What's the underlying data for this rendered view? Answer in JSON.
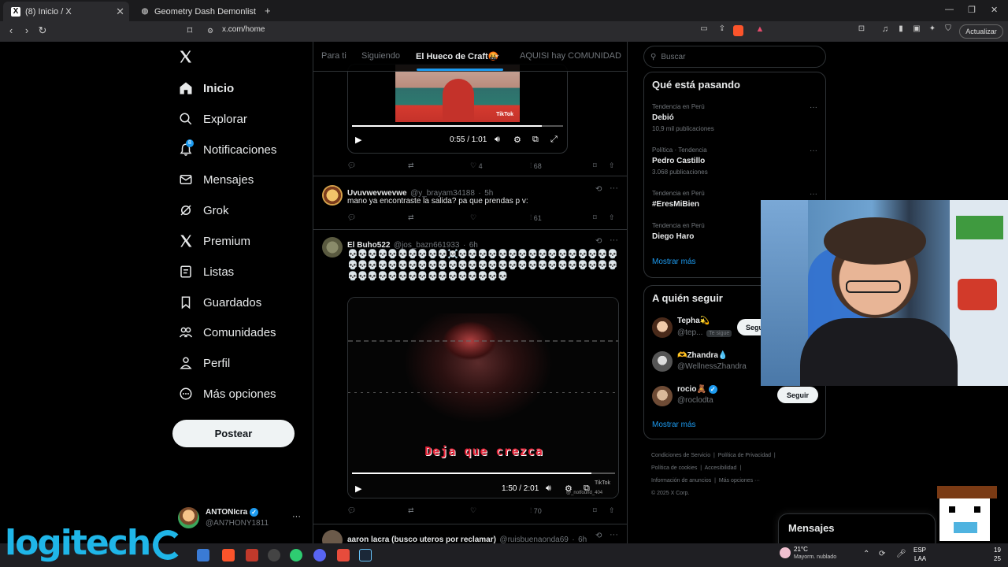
{
  "browser": {
    "tabs": [
      {
        "title": "(8) Inicio / X",
        "icon": "x-logo-icon",
        "active": true
      },
      {
        "title": "Geometry Dash Demonlist",
        "icon": "globe-icon",
        "active": false
      }
    ],
    "url": "x.com/home",
    "update_label": "Actualizar"
  },
  "sidebar": {
    "items": [
      {
        "label": "Inicio",
        "icon": "home-icon"
      },
      {
        "label": "Explorar",
        "icon": "search-icon"
      },
      {
        "label": "Notificaciones",
        "icon": "bell-icon",
        "badge": "8"
      },
      {
        "label": "Mensajes",
        "icon": "mail-icon"
      },
      {
        "label": "Grok",
        "icon": "grok-icon"
      },
      {
        "label": "Premium",
        "icon": "x-logo-icon"
      },
      {
        "label": "Listas",
        "icon": "list-icon"
      },
      {
        "label": "Guardados",
        "icon": "bookmark-icon"
      },
      {
        "label": "Comunidades",
        "icon": "communities-icon"
      },
      {
        "label": "Perfil",
        "icon": "person-icon"
      },
      {
        "label": "Más opciones",
        "icon": "more-circle-icon"
      }
    ],
    "post_label": "Postear",
    "account": {
      "name": "ANTONIcra",
      "handle": "@AN7HONY1811",
      "more": "···"
    }
  },
  "feed": {
    "tabs": [
      "Para ti",
      "Siguiendo",
      "El Hueco de Craft🤬",
      "AQUISI hay COMUNIDAD"
    ],
    "posts": [
      {
        "video": {
          "time": "0:55 / 1:01",
          "watermark": "TikTok",
          "progress": 0.9
        },
        "stats": {
          "likes": "4",
          "views": "68"
        }
      },
      {
        "name": "Uvuvwevwevwe",
        "handle": "@y_brayam34188",
        "time": "5h",
        "text": "mano ya encontraste la salida? pa que prendas p v:",
        "stats": {
          "views": "61"
        }
      },
      {
        "name": "El Buho522",
        "handle": "@jos_bazn661933",
        "time": "6h",
        "text": "💀💀💀💀💀💀💀💀💀💀☠️💀💀💀💀💀💀💀💀💀💀💀💀💀💀💀💀💀💀💀💀💀💀💀💀💀💀💀💀💀💀💀💀💀💀💀💀💀💀💀💀💀💀💀💀💀💀💀💀💀💀💀💀💀💀💀💀💀💀💀",
        "video": {
          "time": "1:50 / 2:01",
          "caption": "Deja que crezca",
          "watermark": "TikTok",
          "tiktok_handle": "@_notfound_404",
          "progress": 0.91
        },
        "stats": {
          "views": "70"
        }
      },
      {
        "name": "aaron lacra (busco uteros por reclamar)",
        "handle": "@ruisbuenaonda69",
        "time": "6h"
      }
    ]
  },
  "right": {
    "search_placeholder": "Buscar",
    "trends_title": "Qué está pasando",
    "trends": [
      {
        "context": "Tendencia en Perú",
        "name": "Debió",
        "count": "10,9 mil publicaciones"
      },
      {
        "context": "Política · Tendencia",
        "name": "Pedro Castillo",
        "count": "3.068 publicaciones"
      },
      {
        "context": "Tendencia en Perú",
        "name": "#EresMiBien",
        "count": ""
      },
      {
        "context": "Tendencia en Perú",
        "name": "Diego Haro",
        "count": ""
      }
    ],
    "show_more": "Mostrar más",
    "follow_title": "A quién seguir",
    "follow": [
      {
        "name": "Tepha💫",
        "handle": "@tep...",
        "badge": "Te sigue",
        "button": "Segu"
      },
      {
        "name": "🫶Zhandra💧",
        "handle": "@WellnessZhandra",
        "button": ""
      },
      {
        "name": "rocio🧸",
        "handle": "@roclodta",
        "button": "Seguir"
      }
    ],
    "footer": [
      "Condiciones de Servicio",
      "Política de Privacidad",
      "Política de cookies",
      "Accesibilidad",
      "Información de anuncios",
      "Más opciones ···",
      "© 2025 X Corp."
    ],
    "messages_title": "Mensajes"
  },
  "taskbar": {
    "weather_temp": "21°C",
    "weather_desc": "Mayorm. nublado",
    "lang": "ESP",
    "lang2": "LAA",
    "clock1": "19",
    "clock2": "25",
    "logo": "logitech"
  }
}
